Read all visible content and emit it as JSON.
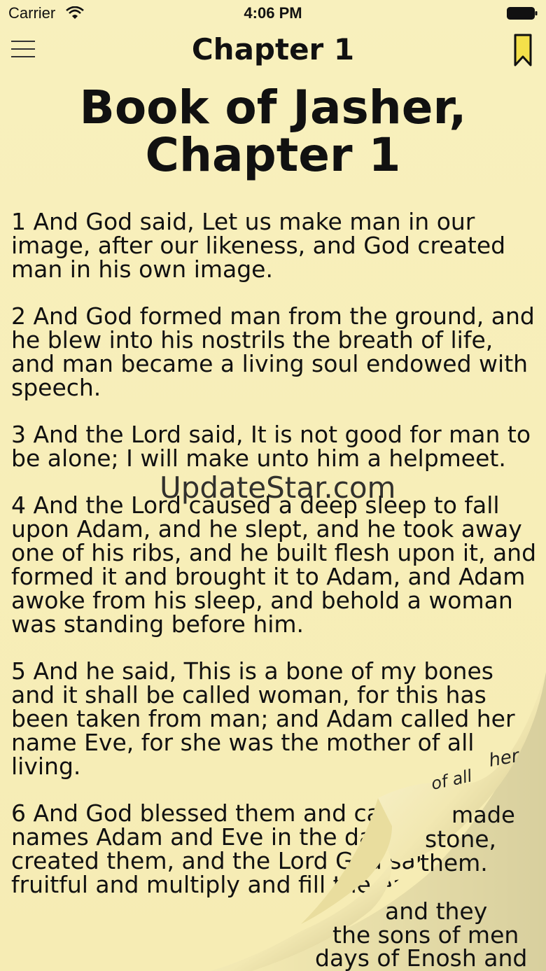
{
  "status_bar": {
    "carrier": "Carrier",
    "time": "4:06 PM"
  },
  "nav": {
    "title": "Chapter 1"
  },
  "page": {
    "heading": "Book of Jasher, Chapter 1",
    "verses": [
      "1 And God said, Let us make man in our image, after our likeness, and God created man in his own image.",
      "2 And God formed man from the ground, and he blew into his nostrils the breath of life, and man became a living soul endowed with speech.",
      "3 And the Lord said, It is not good for man to be alone; I will make unto him a helpmeet.",
      "4 And the Lord caused a deep sleep to fall upon Adam, and he slept, and he took away one of his ribs, and he built flesh upon it, and formed it and brought it to Adam, and Adam awoke from his sleep, and behold a woman was standing before him.",
      "5 And he said, This is a bone of my bones and it shall be called woman, for this has been taken from man; and Adam called her name Eve, for she was the mother of all living.",
      "6 And God blessed them and called their names Adam and Eve in the day that he created them, and the Lord God said, Be fruitful and multiply and fill the earth."
    ]
  },
  "watermark": "UpdateStar.com",
  "curl_back_text": [
    "her",
    "of all",
    "made",
    "stone,",
    "them.",
    "and they",
    "the sons of men",
    "days of Enosh and"
  ],
  "colors": {
    "paper": "#f7eeb8",
    "bookmark": "#f4e04a"
  }
}
